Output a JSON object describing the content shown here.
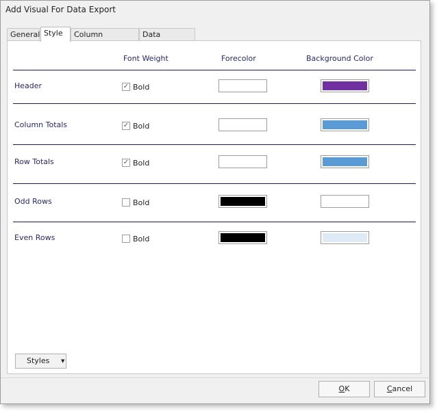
{
  "window": {
    "title": "Add Visual For Data Export"
  },
  "tabs": [
    {
      "label": "General"
    },
    {
      "label": "Style"
    },
    {
      "label": "Column Formatting"
    },
    {
      "label": "Data Validation"
    }
  ],
  "columns": {
    "font_weight": "Font Weight",
    "forecolor": "Forecolor",
    "background": "Background Color"
  },
  "rows": [
    {
      "label": "Header",
      "bold_label": "Bold",
      "bold_checked": true,
      "forecolor": "#ffffff",
      "background": "#7030a0"
    },
    {
      "label": "Column Totals",
      "bold_label": "Bold",
      "bold_checked": true,
      "forecolor": "#ffffff",
      "background": "#5b9bd5"
    },
    {
      "label": "Row Totals",
      "bold_label": "Bold",
      "bold_checked": true,
      "forecolor": "#ffffff",
      "background": "#5b9bd5"
    },
    {
      "label": "Odd Rows",
      "bold_label": "Bold",
      "bold_checked": false,
      "forecolor": "#000000",
      "background": "#ffffff"
    },
    {
      "label": "Even Rows",
      "bold_label": "Bold",
      "bold_checked": false,
      "forecolor": "#000000",
      "background": "#deeaf6"
    }
  ],
  "styles_button": {
    "label": "Styles"
  },
  "buttons": {
    "ok": {
      "first": "O",
      "rest": "K"
    },
    "cancel": {
      "first": "C",
      "rest": "ancel"
    }
  },
  "icons": {
    "check": "checkmark-icon",
    "dropdown": "triangle-down-icon"
  }
}
